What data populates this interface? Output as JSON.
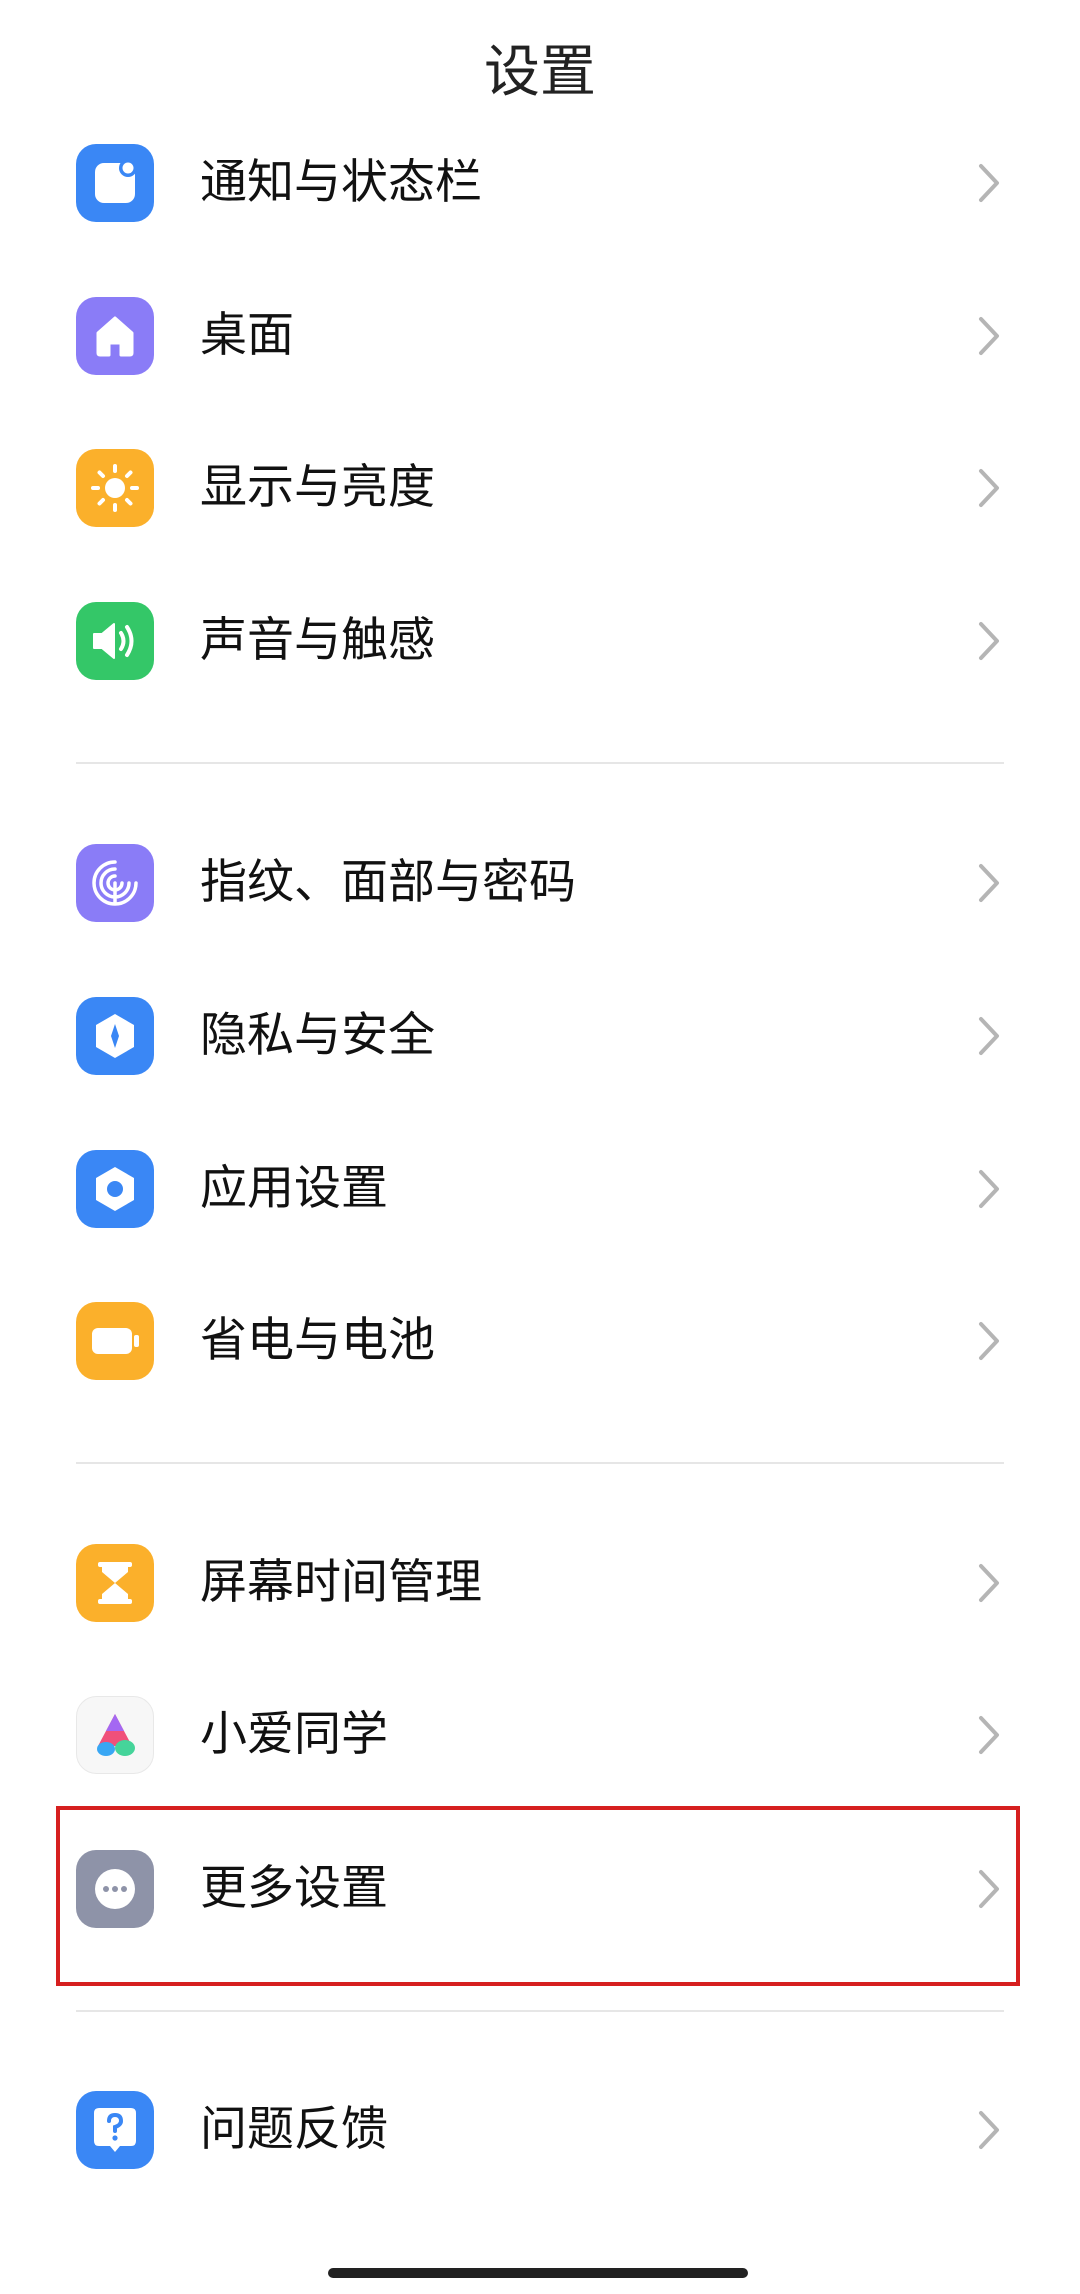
{
  "header": {
    "title": "设置"
  },
  "settings": [
    {
      "label": "通知与状态栏",
      "icon": "notification-icon",
      "color": "#3a87f5"
    },
    {
      "label": "桌面",
      "icon": "home-icon",
      "color": "#8a7cf7"
    },
    {
      "label": "显示与亮度",
      "icon": "sun-icon",
      "color": "#fbb02b"
    },
    {
      "label": "声音与触感",
      "icon": "speaker-icon",
      "color": "#34c768"
    },
    {
      "label": "指纹、面部与密码",
      "icon": "fingerprint-icon",
      "color": "#8a7cf7"
    },
    {
      "label": "隐私与安全",
      "icon": "shield-icon",
      "color": "#3a87f5"
    },
    {
      "label": "应用设置",
      "icon": "hexagon-gear-icon",
      "color": "#3a87f5"
    },
    {
      "label": "省电与电池",
      "icon": "battery-icon",
      "color": "#fbb02b"
    },
    {
      "label": "屏幕时间管理",
      "icon": "hourglass-icon",
      "color": "#fbb02b"
    },
    {
      "label": "小爱同学",
      "icon": "xiaoai-assistant-icon",
      "color": "#f6f6f6"
    },
    {
      "label": "更多设置",
      "icon": "more-dots-icon",
      "color": "#8e93a8"
    },
    {
      "label": "问题反馈",
      "icon": "question-icon",
      "color": "#3a87f5"
    }
  ],
  "highlight_color": "#d61f1f"
}
